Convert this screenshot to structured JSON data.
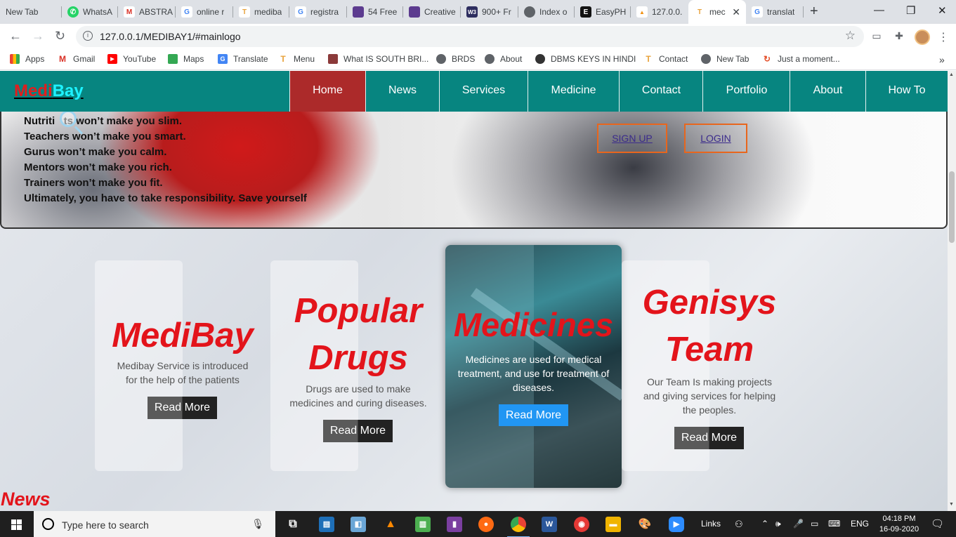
{
  "browser": {
    "tabs": [
      {
        "label": "New Tab",
        "icon": "none",
        "color": "#dee1e6"
      },
      {
        "label": "WhatsA",
        "icon": "whatsapp-icon",
        "color": "#25d366"
      },
      {
        "label": "ABSTRA",
        "icon": "gmail-icon",
        "color": "#d93025"
      },
      {
        "label": "online r",
        "icon": "google-icon",
        "color": "#4285f4"
      },
      {
        "label": "mediba",
        "icon": "medibay-icon",
        "color": "#e8a33d"
      },
      {
        "label": "registra",
        "icon": "google-icon",
        "color": "#4285f4"
      },
      {
        "label": "54 Free",
        "icon": "colorlib-icon",
        "color": "#5c3b8f"
      },
      {
        "label": "Creative",
        "icon": "colorlib-icon",
        "color": "#5c3b8f"
      },
      {
        "label": "900+ Fr",
        "icon": "w3layouts-icon",
        "color": "#2d2d5f"
      },
      {
        "label": "Index o",
        "icon": "globe-icon",
        "color": "#5f6368"
      },
      {
        "label": "EasyPH",
        "icon": "easyphp-icon",
        "color": "#111111"
      },
      {
        "label": "127.0.0.",
        "icon": "pma-icon",
        "color": "#f29111"
      },
      {
        "label": "mec",
        "icon": "medibay-icon",
        "color": "#e8a33d"
      },
      {
        "label": "translat",
        "icon": "google-icon",
        "color": "#4285f4"
      }
    ],
    "url": "127.0.0.1/MEDIBAY1/#mainlogo",
    "bookmarks": [
      {
        "label": "Apps",
        "icon": "apps-grid-icon",
        "color": "#ea4335"
      },
      {
        "label": "Gmail",
        "icon": "gmail-icon",
        "color": "#d93025"
      },
      {
        "label": "YouTube",
        "icon": "youtube-icon",
        "color": "#ff0000"
      },
      {
        "label": "Maps",
        "icon": "maps-icon",
        "color": "#34a853"
      },
      {
        "label": "Translate",
        "icon": "translate-icon",
        "color": "#4285f4"
      },
      {
        "label": "Menu",
        "icon": "medibay-icon",
        "color": "#e8a33d"
      },
      {
        "label": "What IS SOUTH BRI...",
        "icon": "image-icon",
        "color": "#8b3a3a"
      },
      {
        "label": "BRDS",
        "icon": "globe-icon",
        "color": "#5f6368"
      },
      {
        "label": "About",
        "icon": "globe-icon",
        "color": "#5f6368"
      },
      {
        "label": "DBMS KEYS IN HINDI",
        "icon": "eye-icon",
        "color": "#333333"
      },
      {
        "label": "Contact",
        "icon": "medibay-icon",
        "color": "#e8a33d"
      },
      {
        "label": "New Tab",
        "icon": "globe-icon",
        "color": "#5f6368"
      },
      {
        "label": "Just a moment...",
        "icon": "loading-icon",
        "color": "#e44d26"
      }
    ]
  },
  "site": {
    "logo_part1": "Medi",
    "logo_part2": "Bay",
    "nav": [
      "Home",
      "News",
      "Services",
      "Medicine",
      "Contact",
      "Portfolio",
      "About",
      "How To"
    ],
    "hero": {
      "quote_lines": [
        "Nutriti   ts won’t make you slim.",
        "Teachers won’t make you smart.",
        "Gurus won’t make you calm.",
        "Mentors won’t make you rich.",
        "Trainers won’t make you fit.",
        "Ultimately, you have to take responsibility. Save yourself"
      ],
      "signup_label": "SIGN UP",
      "login_label": "LOGIN"
    },
    "cards": [
      {
        "title_lines": [
          "MediBay"
        ],
        "text_lines": [
          "Medibay Service is introduced",
          "for the help of the patients"
        ],
        "button": "Read More"
      },
      {
        "title_lines": [
          "Popular",
          "Drugs"
        ],
        "text_lines": [
          "Drugs are used to make",
          "medicines and curing diseases."
        ],
        "button": "Read More"
      },
      {
        "title_lines": [
          "Medicines"
        ],
        "text_lines": [
          "Medicines are used for medical",
          "treatment, and use for treatment of",
          "diseases."
        ],
        "button": "Read More"
      },
      {
        "title_lines": [
          "Genisys",
          "Team"
        ],
        "text_lines": [
          "Our Team Is making projects",
          "and giving services for helping",
          "the peoples."
        ],
        "button": "Read More"
      }
    ],
    "news_heading": "News"
  },
  "taskbar": {
    "search_placeholder": "Type here to search",
    "links_label": "Links",
    "language": "ENG",
    "time": "04:18 PM",
    "date": "16-09-2020"
  }
}
